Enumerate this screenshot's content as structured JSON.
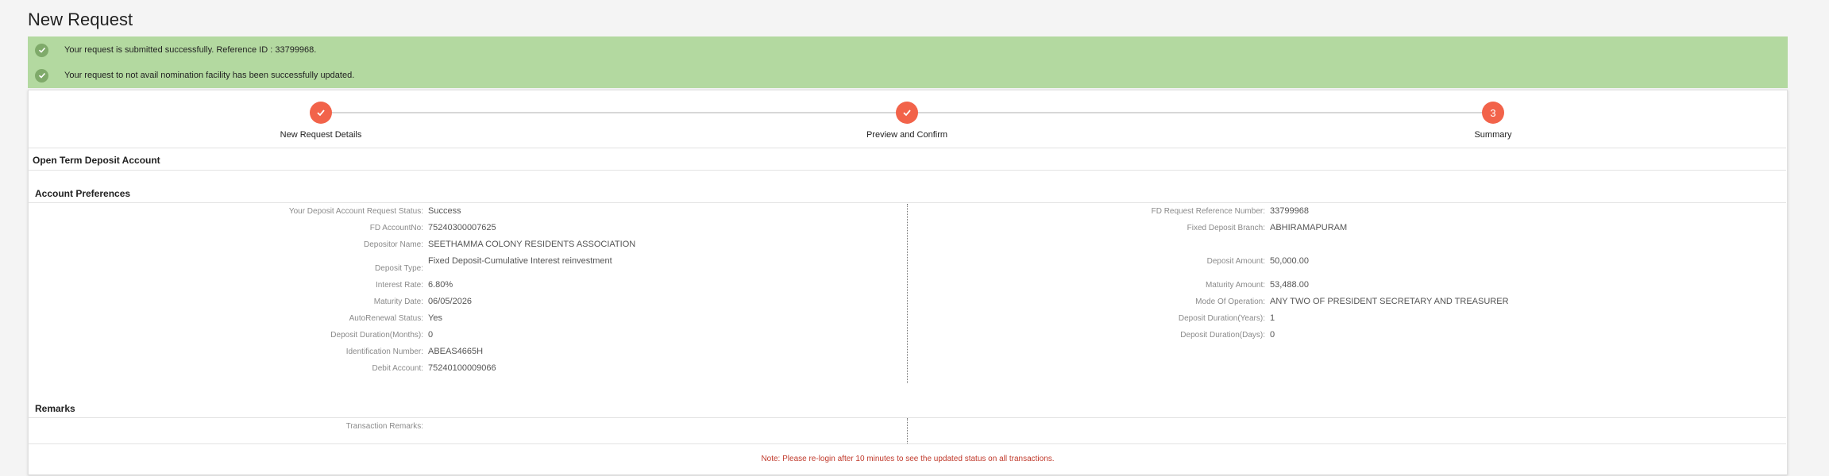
{
  "page_title": "New Request",
  "alerts": [
    "Your request is submitted successfully. Reference ID : 33799968.",
    "Your request to not avail nomination facility has been successfully updated."
  ],
  "steps": [
    {
      "label": "New Request Details",
      "state": "done"
    },
    {
      "label": "Preview and Confirm",
      "state": "done"
    },
    {
      "label": "Summary",
      "state": "current",
      "number": "3"
    }
  ],
  "form_title": "Open Term Deposit Account",
  "account_preferences": {
    "title": "Account Preferences",
    "left": [
      {
        "label": "Your Deposit Account Request Status:",
        "value": "Success"
      },
      {
        "label": "FD AccountNo:",
        "value": "75240300007625"
      },
      {
        "label": "Depositor Name:",
        "value": "SEETHAMMA COLONY RESIDENTS ASSOCIATION"
      },
      {
        "label": "Deposit Type:",
        "value": "Fixed Deposit-Cumulative Interest reinvestment"
      },
      {
        "label": "Interest Rate:",
        "value": "6.80%"
      },
      {
        "label": "Maturity Date:",
        "value": "06/05/2026"
      },
      {
        "label": "AutoRenewal Status:",
        "value": "Yes"
      },
      {
        "label": "Deposit Duration(Months):",
        "value": "0"
      },
      {
        "label": "Identification Number:",
        "value": "ABEAS4665H"
      },
      {
        "label": "Debit Account:",
        "value": "75240100009066"
      }
    ],
    "right": [
      {
        "label": "FD Request Reference Number:",
        "value": "33799968"
      },
      {
        "label": "Fixed Deposit Branch:",
        "value": "ABHIRAMAPURAM"
      },
      {
        "label": "Deposit Amount:",
        "value": "50,000.00"
      },
      {
        "label": "Maturity Amount:",
        "value": "53,488.00"
      },
      {
        "label": "Mode Of Operation:",
        "value": "ANY TWO OF PRESIDENT SECRETARY AND TREASURER"
      },
      {
        "label": "Deposit Duration(Years):",
        "value": "1"
      },
      {
        "label": "Deposit Duration(Days):",
        "value": "0"
      }
    ]
  },
  "remarks": {
    "title": "Remarks",
    "label": "Transaction Remarks:",
    "value": ""
  },
  "note": "Note: Please re-login after 10 minutes to see the updated status on all transactions.",
  "colors": {
    "success_bg": "#b3d9a0",
    "step_accent": "#f2634a",
    "note_red": "#c0392b"
  }
}
